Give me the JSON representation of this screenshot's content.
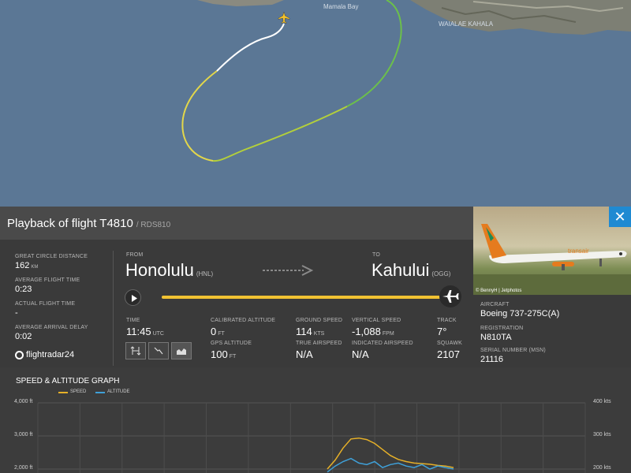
{
  "map": {
    "labels": [
      "Mamala Bay",
      "WAIALAE KAHALA"
    ]
  },
  "flight": {
    "title": "Playback of flight T4810",
    "subtitle": "/ RDS810",
    "from_label": "FROM",
    "from_city": "Honolulu",
    "from_code": "(HNL)",
    "to_label": "TO",
    "to_city": "Kahului",
    "to_code": "(OGG)"
  },
  "left_stats": {
    "gcd_label": "GREAT CIRCLE DISTANCE",
    "gcd_value": "162",
    "gcd_unit": "KM",
    "aft_label": "AVERAGE FLIGHT TIME",
    "aft_value": "0:23",
    "act_label": "ACTUAL FLIGHT TIME",
    "act_value": "-",
    "aad_label": "AVERAGE ARRIVAL DELAY",
    "aad_value": "0:02",
    "logo": "flightradar24"
  },
  "playback": {
    "progress": 1.0,
    "time_label": "TIME",
    "time_value": "11:45",
    "time_unit": "UTC"
  },
  "readouts": {
    "cal_alt_label": "CALIBRATED ALTITUDE",
    "cal_alt_value": "0",
    "cal_alt_unit": "FT",
    "gps_alt_label": "GPS ALTITUDE",
    "gps_alt_value": "100",
    "gps_alt_unit": "FT",
    "gs_label": "GROUND SPEED",
    "gs_value": "114",
    "gs_unit": "KTS",
    "tas_label": "TRUE AIRSPEED",
    "tas_value": "N/A",
    "vs_label": "VERTICAL SPEED",
    "vs_value": "-1,088",
    "vs_unit": "FPM",
    "ias_label": "INDICATED AIRSPEED",
    "ias_value": "N/A",
    "track_label": "TRACK",
    "track_value": "7°",
    "squawk_label": "SQUAWK",
    "squawk_value": "2107"
  },
  "aircraft": {
    "photo_credit": "© BennyH | Jetphotos",
    "livery_text": "transair",
    "aircraft_label": "AIRCRAFT",
    "aircraft_value": "Boeing 737-275C(A)",
    "reg_label": "REGISTRATION",
    "reg_value": "N810TA",
    "msn_label": "SERIAL NUMBER (MSN)",
    "msn_value": "21116"
  },
  "graph": {
    "title": "SPEED & ALTITUDE GRAPH",
    "legend_speed": "SPEED",
    "legend_alt": "ALTITUDE",
    "left_ticks": [
      "4,000 ft",
      "3,000 ft",
      "2,000 ft"
    ],
    "right_ticks": [
      "400 kts",
      "300 kts",
      "200 kts"
    ],
    "speed_color": "#e6b028",
    "alt_color": "#3fa0d8"
  },
  "chart_data": {
    "type": "line",
    "title": "SPEED & ALTITUDE GRAPH",
    "series": [
      {
        "name": "SPEED",
        "axis": "right",
        "unit": "kts",
        "x": [
          0,
          1,
          2,
          3,
          4,
          5,
          6,
          7,
          8,
          9,
          10,
          11,
          12,
          13,
          14,
          15,
          16
        ],
        "values": [
          180,
          210,
          250,
          280,
          283,
          278,
          265,
          245,
          225,
          212,
          205,
          200,
          198,
          196,
          192,
          190,
          185
        ]
      },
      {
        "name": "ALTITUDE",
        "axis": "left",
        "unit": "ft",
        "x": [
          0,
          1,
          2,
          3,
          4,
          5,
          6,
          7,
          8,
          9,
          10,
          11,
          12,
          13,
          14,
          15,
          16
        ],
        "values": [
          1700,
          1900,
          2050,
          2150,
          2000,
          1950,
          2050,
          1850,
          1950,
          2000,
          1900,
          1850,
          1950,
          1800,
          1900,
          1850,
          1800
        ]
      }
    ],
    "left_axis_ticks": [
      "4,000 ft",
      "3,000 ft",
      "2,000 ft"
    ],
    "right_axis_ticks": [
      "400 kts",
      "300 kts",
      "200 kts"
    ],
    "ylim_left": [
      1800,
      4000
    ],
    "ylim_right": [
      180,
      400
    ],
    "grid": true,
    "legend": "top-left"
  }
}
